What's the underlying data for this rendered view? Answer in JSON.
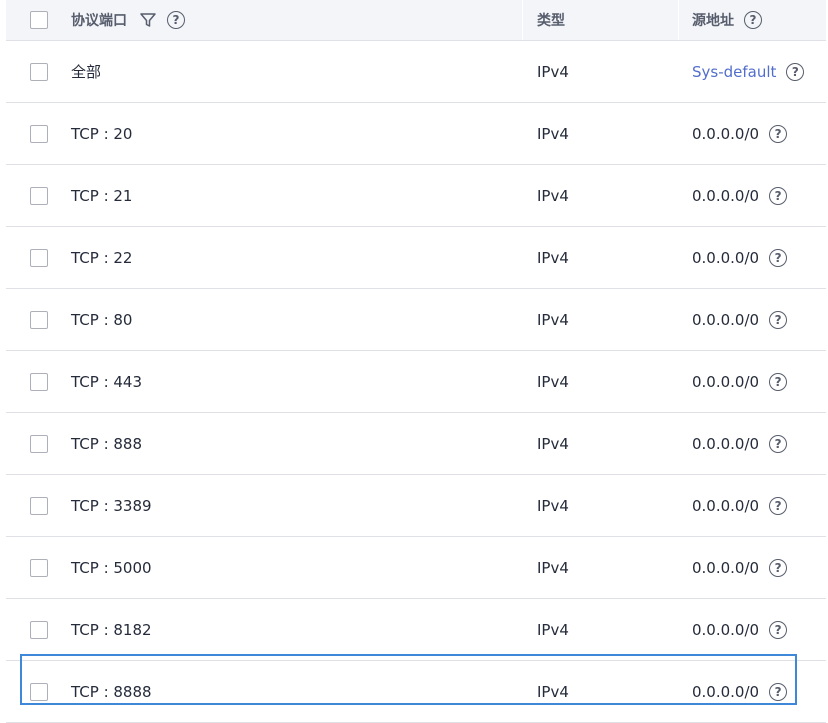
{
  "header": {
    "port_label": "协议端口",
    "type_label": "类型",
    "source_label": "源地址"
  },
  "rows": [
    {
      "port": "全部",
      "type": "IPv4",
      "source": "Sys-default",
      "source_is_link": true
    },
    {
      "port": "TCP : 20",
      "type": "IPv4",
      "source": "0.0.0.0/0"
    },
    {
      "port": "TCP : 21",
      "type": "IPv4",
      "source": "0.0.0.0/0"
    },
    {
      "port": "TCP : 22",
      "type": "IPv4",
      "source": "0.0.0.0/0"
    },
    {
      "port": "TCP : 80",
      "type": "IPv4",
      "source": "0.0.0.0/0"
    },
    {
      "port": "TCP : 443",
      "type": "IPv4",
      "source": "0.0.0.0/0"
    },
    {
      "port": "TCP : 888",
      "type": "IPv4",
      "source": "0.0.0.0/0"
    },
    {
      "port": "TCP : 3389",
      "type": "IPv4",
      "source": "0.0.0.0/0"
    },
    {
      "port": "TCP : 5000",
      "type": "IPv4",
      "source": "0.0.0.0/0"
    },
    {
      "port": "TCP : 8182",
      "type": "IPv4",
      "source": "0.0.0.0/0"
    },
    {
      "port": "TCP : 8888",
      "type": "IPv4",
      "source": "0.0.0.0/0"
    }
  ],
  "colors": {
    "link": "#526ecc",
    "highlight_border": "#3f87d8",
    "header_bg": "#f3f5f9"
  },
  "icons": {
    "filter": "filter-icon",
    "help": "help-icon"
  }
}
